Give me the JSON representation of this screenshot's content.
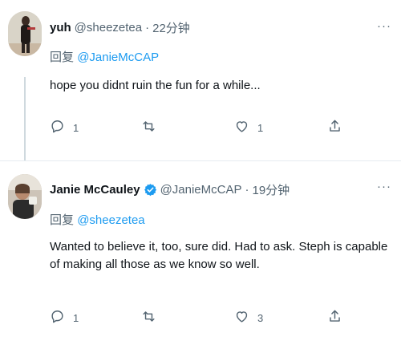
{
  "tweets": [
    {
      "display_name": "yuh",
      "handle": "@sheezetea",
      "time": "22分钟",
      "reply_prefix": "回复",
      "reply_to": "@JanieMcCAP",
      "text": "hope you didnt ruin the fun for a while...",
      "reply_count": "1",
      "retweet_count": "",
      "like_count": "1",
      "more": "···"
    },
    {
      "display_name": "Janie McCauley",
      "handle": "@JanieMcCAP",
      "time": "19分钟",
      "verified": true,
      "reply_prefix": "回复",
      "reply_to": "@sheezetea",
      "text": "Wanted to believe it, too, sure did. Had to ask. Steph is capable of making all those as we know so well.",
      "reply_count": "1",
      "retweet_count": "",
      "like_count": "3",
      "more": "···"
    }
  ],
  "separator": "·",
  "colors": {
    "accent": "#1d9bf0",
    "muted": "#536471",
    "text": "#0f1419"
  },
  "icons": [
    "reply-icon",
    "retweet-icon",
    "like-icon",
    "share-icon",
    "verified-badge-icon",
    "more-icon"
  ]
}
